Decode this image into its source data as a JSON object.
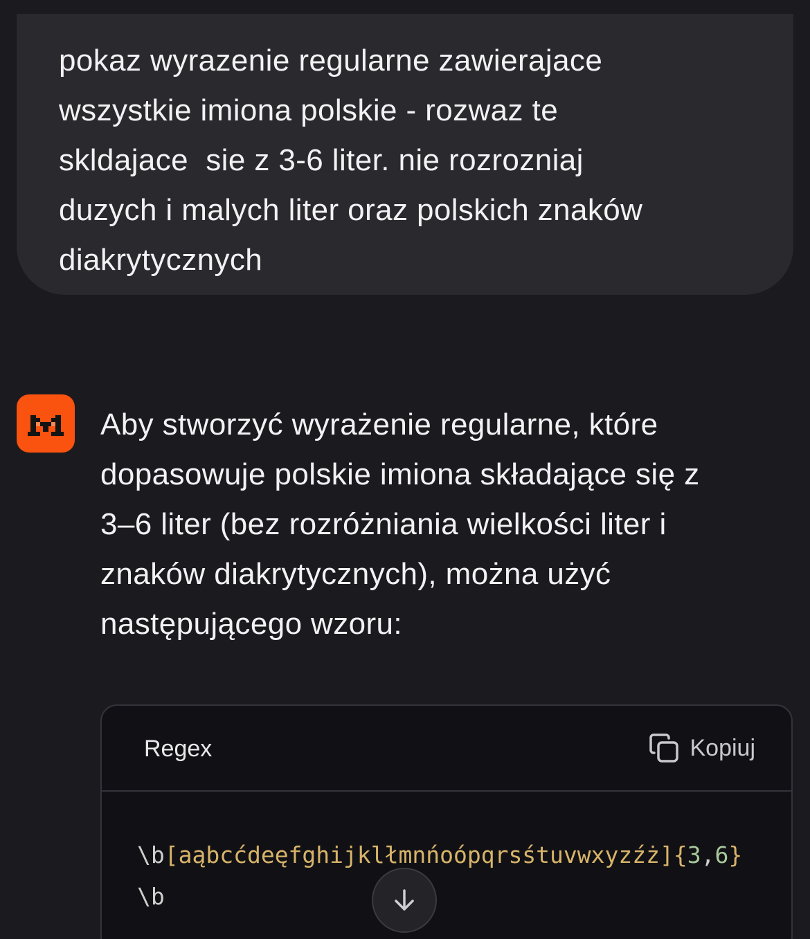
{
  "user_message": {
    "text": "pokaz wyrazenie regularne zawierajace\nwszystkie imiona polskie - rozwaz te\nskldajace  sie z 3-6 liter. nie rozrozniaj\nduzych i malych liter oraz polskich znaków\ndiakrytycznych"
  },
  "assistant": {
    "avatar_icon": "mistral-logo-icon",
    "avatar_color": "#fa520f",
    "text": "Aby stworzyć wyrażenie regularne, które\ndopasowuje polskie imiona składające się z\n3–6 liter (bez rozróżniania wielkości liter i\nznaków diakrytycznych), można użyć\nnastępującego wzoru:"
  },
  "code_block": {
    "language": "Regex",
    "copy_label": "Kopiuj",
    "copy_icon": "copy-icon",
    "tokens": {
      "boundary_start": "\\b",
      "char_class": "[aąbcćdeęfghijklłmnńoópqrsśtuvwxyzźż]",
      "brace_open": "{",
      "min": "3",
      "comma": ",",
      "max": "6",
      "brace_close": "}",
      "boundary_end": "\\b"
    }
  },
  "scroll_button": {
    "icon": "arrow-down-icon"
  }
}
